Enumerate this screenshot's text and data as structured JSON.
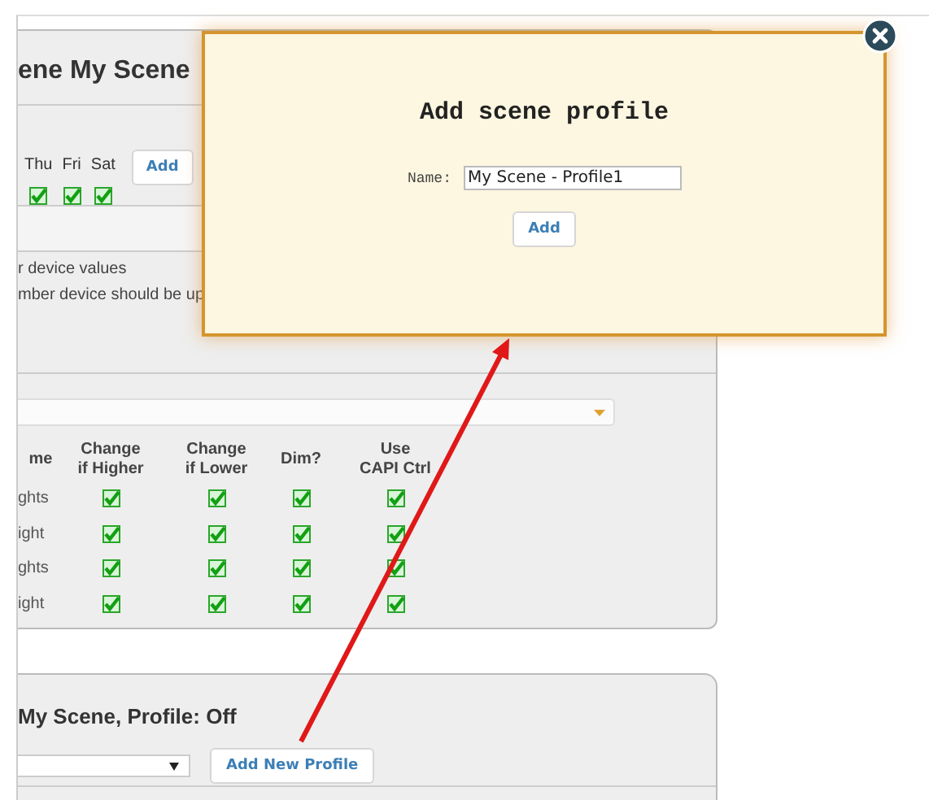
{
  "scene_panel": {
    "title": "ene My Scene",
    "days": [
      {
        "label": "Thu",
        "checked": true
      },
      {
        "label": "Fri",
        "checked": true
      },
      {
        "label": "Sat",
        "checked": true
      }
    ],
    "add_button": "Add",
    "notes": [
      "r device values",
      "mber device should be up"
    ],
    "table": {
      "columns": [
        "me",
        "Change\nif Higher",
        "Change\nif Lower",
        "Dim?",
        "Use\nCAPI Ctrl"
      ],
      "rows": [
        {
          "name": "ghts",
          "change_if_higher": true,
          "change_if_lower": true,
          "dim": true,
          "use_capi_ctrl": true
        },
        {
          "name": "ight",
          "change_if_higher": true,
          "change_if_lower": true,
          "dim": true,
          "use_capi_ctrl": true
        },
        {
          "name": "ghts",
          "change_if_higher": true,
          "change_if_lower": true,
          "dim": true,
          "use_capi_ctrl": true
        },
        {
          "name": "ight",
          "change_if_higher": true,
          "change_if_lower": true,
          "dim": true,
          "use_capi_ctrl": true
        }
      ]
    }
  },
  "profile_panel": {
    "title": "My Scene, Profile: Off",
    "add_button": "Add New Profile"
  },
  "dialog": {
    "title": "Add scene profile",
    "name_label": "Name:",
    "name_value": "My Scene - Profile1",
    "button": "Add"
  }
}
